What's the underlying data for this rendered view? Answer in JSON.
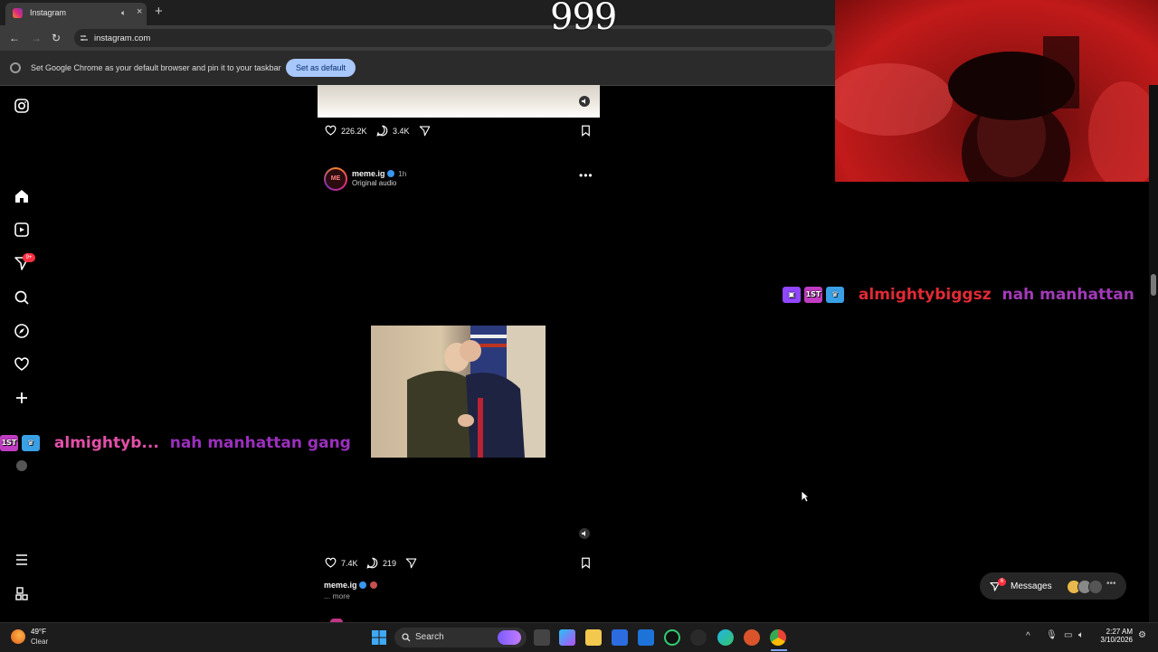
{
  "browser": {
    "tab_title": "Instagram",
    "url": "instagram.com",
    "infobar_message": "Set Google Chrome as your default browser and pin it to your taskbar",
    "infobar_button": "Set as default"
  },
  "overlay": {
    "counter": "999"
  },
  "nav": {
    "notification_badge": "9+"
  },
  "feed": {
    "prev_post": {
      "likes": "226.2K",
      "comments": "3.4K"
    },
    "post": {
      "username": "meme.ig",
      "time": "1h",
      "audio": "Original audio",
      "avatar_text": "ME",
      "likes": "7.4K",
      "comments": "219",
      "caption_user": "meme.ig",
      "caption_more": "... more"
    }
  },
  "chat_overlays": [
    {
      "user": "almightybiggsz",
      "message": "nah manhattan"
    },
    {
      "user": "almightyb...",
      "message": "nah manhattan gang"
    }
  ],
  "messages": {
    "label": "Messages",
    "count": "6"
  },
  "taskbar": {
    "weather_temp": "49°F",
    "weather_condition": "Clear",
    "search_label": "Search",
    "time": "2:27 AM",
    "date": "3/10/2026"
  },
  "colors": {
    "chat_user_1": "#e02a35",
    "chat_message_1": "#a23ab8",
    "chat_user_2": "#e24fa8",
    "chat_message_2": "#9a2fbc",
    "instagram_badge": "#ff3040",
    "infobar_button": "#a8c7fa"
  },
  "icons": {
    "nav": [
      "instagram-logo-icon",
      "home-icon",
      "reels-icon",
      "messages-icon",
      "search-icon",
      "explore-icon",
      "heart-icon",
      "create-icon",
      "menu-icon",
      "more-icon"
    ]
  }
}
